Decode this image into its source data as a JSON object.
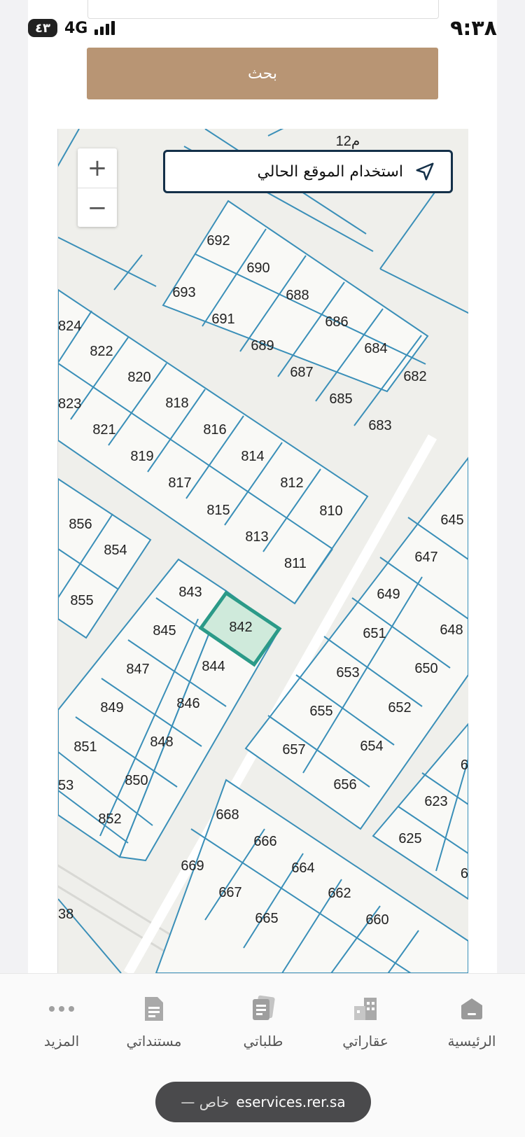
{
  "status_bar": {
    "battery": "٤٣",
    "network": "4G",
    "time": "٩:٣٨"
  },
  "search": {
    "button_label": "بحث"
  },
  "map": {
    "location_button_label": "استخدام الموقع الحالي",
    "street_label": "12م",
    "selected_plot": "842",
    "blocks": [
      {
        "id": "block-690s",
        "plots": [
          {
            "n": "692"
          },
          {
            "n": "690"
          },
          {
            "n": "688"
          },
          {
            "n": "686"
          },
          {
            "n": "684"
          },
          {
            "n": "682"
          },
          {
            "n": "693"
          },
          {
            "n": "691"
          },
          {
            "n": "689"
          },
          {
            "n": "687"
          },
          {
            "n": "685"
          },
          {
            "n": "683"
          }
        ]
      },
      {
        "id": "block-810s",
        "plots": [
          {
            "n": "824"
          },
          {
            "n": "822"
          },
          {
            "n": "820"
          },
          {
            "n": "818"
          },
          {
            "n": "816"
          },
          {
            "n": "814"
          },
          {
            "n": "812"
          },
          {
            "n": "810"
          },
          {
            "n": "823"
          },
          {
            "n": "821"
          },
          {
            "n": "819"
          },
          {
            "n": "817"
          },
          {
            "n": "815"
          },
          {
            "n": "813"
          },
          {
            "n": "811"
          }
        ]
      },
      {
        "id": "block-850s",
        "plots": [
          {
            "n": "856"
          },
          {
            "n": "854"
          },
          {
            "n": "855"
          }
        ]
      },
      {
        "id": "block-840s",
        "plots": [
          {
            "n": "843"
          },
          {
            "n": "842"
          },
          {
            "n": "845"
          },
          {
            "n": "844"
          },
          {
            "n": "847"
          },
          {
            "n": "846"
          },
          {
            "n": "849"
          },
          {
            "n": "848"
          },
          {
            "n": "851"
          },
          {
            "n": "850"
          },
          {
            "n": "53"
          },
          {
            "n": "852"
          }
        ]
      },
      {
        "id": "block-640s",
        "plots": [
          {
            "n": "645"
          },
          {
            "n": "647"
          },
          {
            "n": "649"
          },
          {
            "n": "648"
          },
          {
            "n": "651"
          },
          {
            "n": "650"
          },
          {
            "n": "653"
          },
          {
            "n": "652"
          },
          {
            "n": "655"
          },
          {
            "n": "654"
          },
          {
            "n": "657"
          },
          {
            "n": "656"
          }
        ]
      },
      {
        "id": "block-620s",
        "plots": [
          {
            "n": "6"
          },
          {
            "n": "623"
          },
          {
            "n": "625"
          },
          {
            "n": "6"
          }
        ]
      },
      {
        "id": "block-660s",
        "plots": [
          {
            "n": "668"
          },
          {
            "n": "666"
          },
          {
            "n": "664"
          },
          {
            "n": "662"
          },
          {
            "n": "660"
          },
          {
            "n": "669"
          },
          {
            "n": "667"
          },
          {
            "n": "665"
          },
          {
            "n": "38"
          }
        ]
      }
    ]
  },
  "nav": {
    "items": [
      {
        "label": "الرئيسية",
        "icon": "home-icon"
      },
      {
        "label": "عقاراتي",
        "icon": "buildings-icon"
      },
      {
        "label": "طلباتي",
        "icon": "requests-icon"
      },
      {
        "label": "مستنداتي",
        "icon": "document-icon"
      },
      {
        "label": "المزيد",
        "icon": "more-icon"
      }
    ]
  },
  "browser": {
    "url": "eservices.rer.sa",
    "suffix": "— خاص"
  },
  "colors": {
    "search_button": "#b89574",
    "plot_border": "#3a8fb8",
    "selected_plot": "#2b9a88",
    "location_border": "#143049"
  }
}
